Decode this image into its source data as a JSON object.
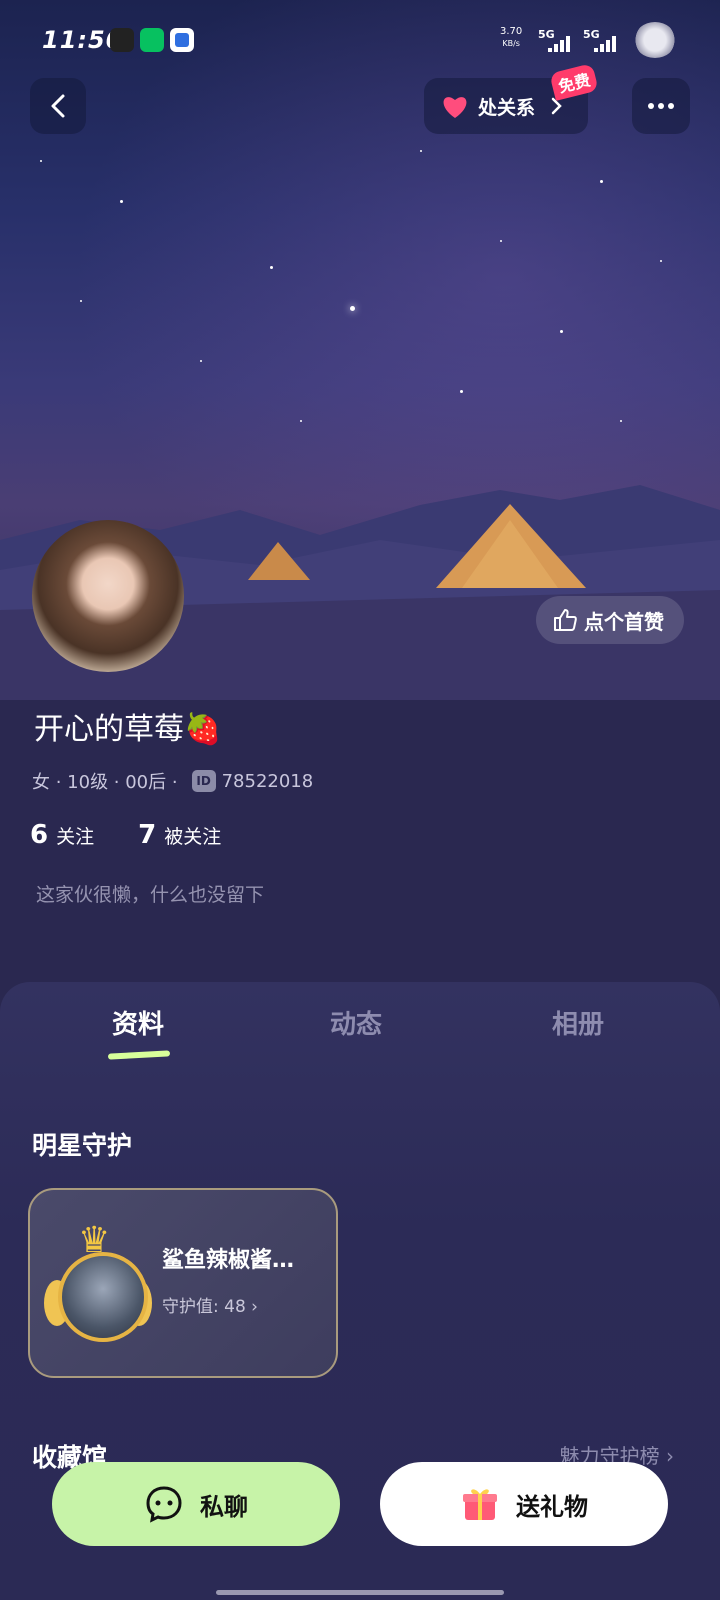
{
  "status_bar": {
    "time": "11:50",
    "net_speed": "3.70",
    "net_unit": "KB/s",
    "sig1": "5G",
    "sig2": "5G"
  },
  "top_bar": {
    "relation_label": "处关系",
    "free_badge": "免费"
  },
  "profile": {
    "like_label": "点个首赞",
    "name": "开心的草莓🍓",
    "meta": "女 · 10级 · 00后 ·",
    "id_badge": "ID",
    "id": "78522018",
    "following_count": "6",
    "following_label": "关注",
    "followers_count": "7",
    "followers_label": "被关注",
    "bio": "这家伙很懒，什么也没留下"
  },
  "tabs": [
    {
      "label": "资料"
    },
    {
      "label": "动态"
    },
    {
      "label": "相册"
    }
  ],
  "guard": {
    "section_title": "明星守护",
    "name": "鲨鱼辣椒酱…",
    "value_label": "守护值: 48"
  },
  "collection": {
    "title": "收藏馆",
    "rank_link": "魅力守护榜"
  },
  "actions": {
    "chat": "私聊",
    "gift": "送礼物"
  },
  "colors": {
    "background": "#2a2850",
    "chat_button": "#c7f3a8",
    "gift_button": "#ffffff",
    "free_badge": "#ff3b6b",
    "tab_underline": "#d8ff9a"
  }
}
